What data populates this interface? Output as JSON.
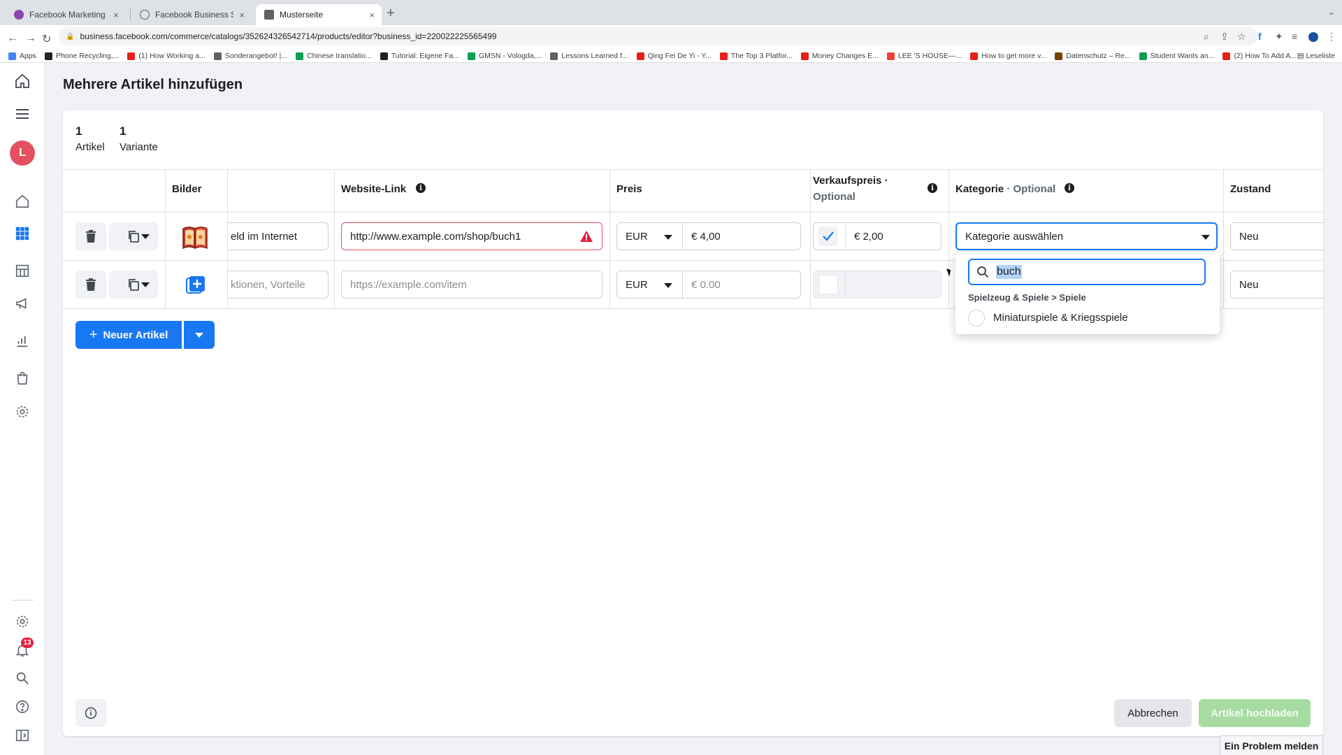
{
  "browser": {
    "tabs": [
      {
        "title": "Facebook Marketing & Werbe",
        "close": "×",
        "favicon_color": "#8e44ad"
      },
      {
        "title": "Facebook Business Suite",
        "close": "×",
        "favicon_color": "#5f6368"
      },
      {
        "title": "Musterseite",
        "close": "×",
        "favicon_color": "#5f6368"
      }
    ],
    "new_tab": "+",
    "url": "business.facebook.com/commerce/catalogs/352624326542714/products/editor?business_id=220022225565499",
    "bookmarks": [
      {
        "label": "Apps",
        "color": "#4285f4"
      },
      {
        "label": "Phone Recycling,...",
        "color": "#202124"
      },
      {
        "label": "(1) How Working a...",
        "color": "#e62117"
      },
      {
        "label": "Sonderangebot! |...",
        "color": "#5f6368"
      },
      {
        "label": "Chinese translatio...",
        "color": "#0f9d58"
      },
      {
        "label": "Tutorial: Eigene Fa...",
        "color": "#202124"
      },
      {
        "label": "GMSN - Vologda,...",
        "color": "#0f9d58"
      },
      {
        "label": "Lessons Learned f...",
        "color": "#5f6368"
      },
      {
        "label": "Qing Fei De Yi - Y...",
        "color": "#e62117"
      },
      {
        "label": "The Top 3 Platfor...",
        "color": "#e62117"
      },
      {
        "label": "Money Changes E...",
        "color": "#e62117"
      },
      {
        "label": "LEE 'S HOUSE—...",
        "color": "#ea4335"
      },
      {
        "label": "How to get more v...",
        "color": "#e62117"
      },
      {
        "label": "Datenschutz – Re...",
        "color": "#7b3f00"
      },
      {
        "label": "Student Wants an...",
        "color": "#0f9d58"
      },
      {
        "label": "(2) How To Add A...",
        "color": "#e62117"
      }
    ],
    "reading_list": "Leseliste"
  },
  "nav": {
    "avatar_letter": "L",
    "notification_count": "13"
  },
  "page": {
    "title": "Mehrere Artikel hinzufügen",
    "counts": [
      {
        "num": "1",
        "label": "Artikel"
      },
      {
        "num": "1",
        "label": "Variante"
      }
    ]
  },
  "table": {
    "headers": {
      "images": "Bilder",
      "website": "Website-Link",
      "price": "Preis",
      "sale_price": "Verkaufspreis ·",
      "sale_price_opt": "Optional",
      "category": "Kategorie",
      "category_opt": " · Optional",
      "condition": "Zustand"
    },
    "rows": [
      {
        "description": "eld im Internet",
        "website": "http://www.example.com/shop/buch1",
        "currency": "EUR",
        "price": "€ 4,00",
        "sale_price": "€ 2,00",
        "category": "Kategorie auswählen",
        "condition": "Neu"
      },
      {
        "description_placeholder": "ktionen, Vorteile",
        "website_placeholder": "https://example.com/item",
        "currency": "EUR",
        "price_placeholder": "€ 0.00",
        "condition": "Neu"
      }
    ]
  },
  "category_dropdown": {
    "search_value": "buch",
    "path": "Spielzeug & Spiele > Spiele",
    "option": "Miniaturspiele & Kriegsspiele"
  },
  "buttons": {
    "new_item": "Neuer Artikel",
    "cancel": "Abbrechen",
    "upload": "Artikel hochladen",
    "report": "Ein Problem melden"
  },
  "colors": {
    "primary": "#1877f2",
    "upload_disabled": "#a7dca0",
    "error": "#e4505f"
  }
}
